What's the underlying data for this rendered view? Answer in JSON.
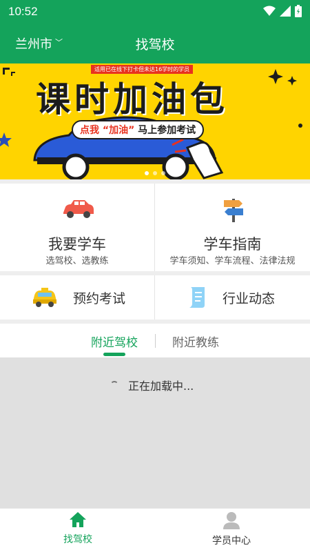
{
  "status_bar": {
    "time": "10:52"
  },
  "app_bar": {
    "city": "兰州市",
    "title": "找驾校"
  },
  "banner": {
    "subtitle": "适用已在线下打卡但未达16学时的学员",
    "headline": "课时加油包",
    "cta_prefix": "点我",
    "cta_highlight": "“加油”",
    "cta_suffix": "马上参加考试"
  },
  "grid": {
    "learn": {
      "title": "我要学车",
      "subtitle": "选驾校、选教练"
    },
    "guide": {
      "title": "学车指南",
      "subtitle": "学车须知、学车流程、法律法规"
    },
    "exam": {
      "title": "预约考试"
    },
    "news": {
      "title": "行业动态"
    }
  },
  "tabs": [
    {
      "label": "附近驾校",
      "active": true
    },
    {
      "label": "附近教练",
      "active": false
    }
  ],
  "loading_text": "正在加载中...",
  "bottom_nav": [
    {
      "label": "找驾校",
      "icon": "home-icon",
      "active": true
    },
    {
      "label": "学员中心",
      "icon": "user-icon",
      "active": false
    }
  ],
  "colors": {
    "brand": "#14a35b",
    "banner_bg": "#ffd400",
    "accent_red": "#e8321f"
  }
}
